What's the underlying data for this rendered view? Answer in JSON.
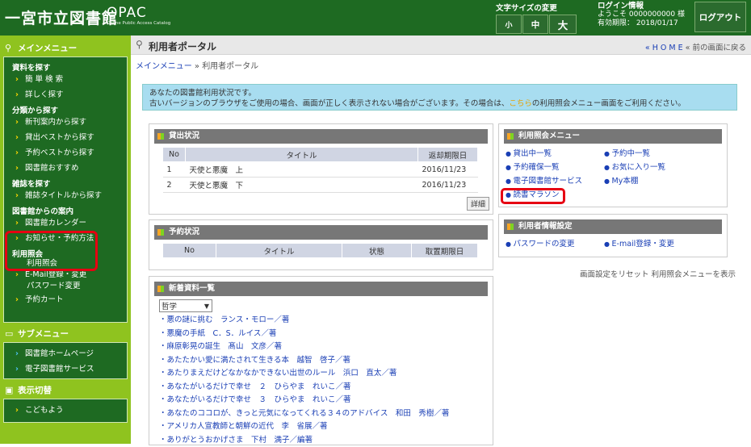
{
  "header": {
    "logo": "一宮市立図書館",
    "opac": "OPAC",
    "opac_sub": "Online Public Access Catalog",
    "font_size_label": "文字サイズの変更",
    "font_small": "小",
    "font_medium": "中",
    "font_large": "大",
    "login_title": "ログイン情報",
    "welcome": "ようこそ 0000000000 様",
    "expiry": "有効期限： 2018/01/17",
    "logout": "ログアウト"
  },
  "sidebar": {
    "main_menu": "メインメニュー",
    "search_cat": "資料を探す",
    "simple_search": "簡 単 検 索",
    "detail_search": "詳しく探す",
    "class_cat": "分類から探す",
    "new_arrivals": "新刊案内から探す",
    "loan_best": "貸出ベストから探す",
    "reserve_best": "予約ベストから探す",
    "lib_recommend": "図書館おすすめ",
    "magazine_cat": "雑誌を探す",
    "magazine_title": "雑誌タイトルから探す",
    "lib_info_cat": "図書館からの案内",
    "calendar": "図書館カレンダー",
    "notice": "お知らせ・予約方法",
    "usage_cat": "利用照会",
    "usage": "利用照会",
    "email": "E-Mail登録・変更",
    "password": "パスワード変更",
    "reserve_cart": "予約カート",
    "sub_menu": "サブメニュー",
    "lib_home": "図書館ホームページ",
    "e_library": "電子図書館サービス",
    "display_switch": "表示切替",
    "kids": "こどもよう"
  },
  "main": {
    "title": "利用者ポータル",
    "home_link": "« H O M E",
    "back_link": "« 前の画面に戻る",
    "breadcrumb_1": "メインメニュー",
    "breadcrumb_sep": " » ",
    "breadcrumb_2": "利用者ポータル",
    "notice_1": "あなたの図書館利用状況です。",
    "notice_2a": "古いバージョンのブラウザをご使用の場合、画面が正しく表示されない場合がございます。その場合は、",
    "notice_here": "こちら",
    "notice_2b": "の利用照会メニュー画面をご利用ください。",
    "loan_title": "貸出状況",
    "loan_headers": [
      "No",
      "タイトル",
      "返却期限日"
    ],
    "loan_rows": [
      {
        "no": "1",
        "title": "天使と悪魔　上",
        "date": "2016/11/23"
      },
      {
        "no": "2",
        "title": "天使と悪魔　下",
        "date": "2016/11/23"
      }
    ],
    "detail_btn": "詳細",
    "reserve_title": "予約状況",
    "reserve_headers": [
      "No",
      "タイトル",
      "状態",
      "取置期限日"
    ],
    "new_title": "新着資料一覧",
    "genre_select": "哲学",
    "new_items": [
      "悪の謎に挑む　ランス・モロー／著",
      "悪魔の手紙　C．S．ルイス／著",
      "麻原彰晃の誕生　髙山　文彦／著",
      "あたたかい愛に満たされて生きる本　越智　啓子／著",
      "あたりまえだけどなかなかできない出世のルール　浜口　直太／著",
      "あなたがいるだけで幸せ　２　ひらやま　れいこ／著",
      "あなたがいるだけで幸せ　３　ひらやま　れいこ／著",
      "あなたのココロが、きっと元気になってくれる３４のアドバイス　和田　秀樹／著",
      "アメリカ人宣教師と朝鮮の近代　李　省展／著",
      "ありがとうおかげさま　下村　満子／編著"
    ],
    "usage_menu_title": "利用照会メニュー",
    "usage_menu": [
      "貸出中一覧",
      "予約中一覧",
      "予約確保一覧",
      "お気に入り一覧",
      "電子図書館サービス",
      "My本棚",
      "読書マラソン"
    ],
    "user_settings_title": "利用者情報設定",
    "user_settings": [
      "パスワードの変更",
      "E-mail登録・変更"
    ],
    "reset_link": "画面設定をリセット",
    "show_menu_link": "利用照会メニューを表示"
  }
}
